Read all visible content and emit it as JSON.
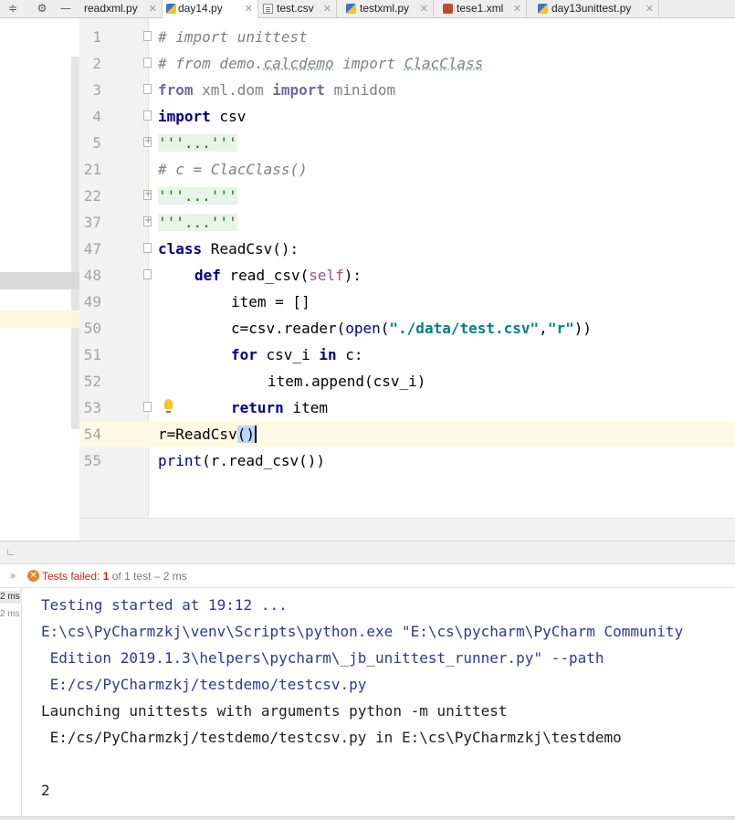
{
  "tabs": [
    {
      "name": "readxml.py",
      "icon": "python-file-icon",
      "active": false
    },
    {
      "name": "day14.py",
      "icon": "python-file-icon",
      "active": true
    },
    {
      "name": "test.csv",
      "icon": "csv-file-icon",
      "active": false
    },
    {
      "name": "testxml.py",
      "icon": "python-file-icon",
      "active": false
    },
    {
      "name": "tese1.xml",
      "icon": "xml-file-icon",
      "active": false
    },
    {
      "name": "day13unittest.py",
      "icon": "python-file-icon",
      "active": false
    }
  ],
  "toolbar": {
    "gear_icon": "gear-icon",
    "hide_icon": "minus-icon",
    "settings_icon": "settings-sliders-icon"
  },
  "editor": {
    "line_numbers": [
      "1",
      "2",
      "3",
      "4",
      "5",
      "21",
      "22",
      "37",
      "47",
      "48",
      "49",
      "50",
      "51",
      "52",
      "53",
      "54",
      "55"
    ],
    "current_line": "54"
  },
  "code": {
    "l1": "# import unittest",
    "l2_a": "# from demo.",
    "l2_b": "calcdemo",
    "l2_c": " import ",
    "l2_d": "ClacClass",
    "l3_kw1": "from",
    "l3_mod": " xml.dom ",
    "l3_kw2": "import",
    "l3_name": " minidom",
    "l4_kw": "import",
    "l4_name": " csv",
    "fold_str": "'''...'''",
    "l21": "# c = ClacClass()",
    "l47_kw": "class",
    "l47_rest": " ReadCsv():",
    "l48_kw": "def",
    "l48_name": " read_csv(",
    "l48_self": "self",
    "l48_end": "):",
    "l49": "item = []",
    "l50_a": "c=csv.reader(",
    "l50_open": "open",
    "l50_b": "(",
    "l50_s1": "\"./data/test.csv\"",
    "l50_c": ",",
    "l50_s2": "\"r\"",
    "l50_d": "))",
    "l51_kw1": "for",
    "l51_mid": " csv_i ",
    "l51_kw2": "in",
    "l51_end": " c:",
    "l52": "item.append(csv_i)",
    "l53_kw": "return",
    "l53_rest": " item",
    "l54_a": "r=ReadCsv",
    "l54_b": "()",
    "l55_print": "print",
    "l55_rest": "(r.read_csv())"
  },
  "run": {
    "status_prefix": "Tests failed: ",
    "failed": "1",
    "rest": " of 1 test – 2 ms",
    "durations": [
      "2 ms",
      "2 ms"
    ]
  },
  "console": {
    "l1": "Testing started at 19:12 ...",
    "l2": "E:\\cs\\PyCharmzkj\\venv\\Scripts\\python.exe \"E:\\cs\\pycharm\\PyCharm Community",
    "l3": " Edition 2019.1.3\\helpers\\pycharm\\_jb_unittest_runner.py\" --path",
    "l4": " E:/cs/PyCharmzkj/testdemo/testcsv.py",
    "l5": "Launching unittests with arguments python -m unittest",
    "l6": " E:/cs/PyCharmzkj/testdemo/testcsv.py in E:\\cs\\PyCharmzkj\\testdemo",
    "l7": "2"
  }
}
